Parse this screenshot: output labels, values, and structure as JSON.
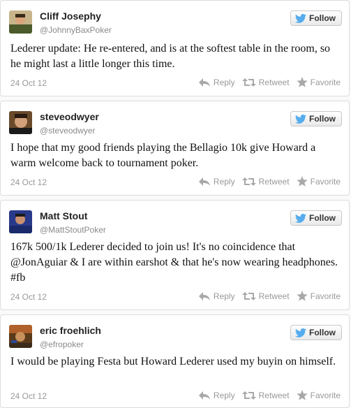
{
  "follow_label": "Follow",
  "actions": {
    "reply": "Reply",
    "retweet": "Retweet",
    "favorite": "Favorite"
  },
  "tweets": [
    {
      "name": "Cliff Josephy",
      "handle": "@JohnnyBaxPoker",
      "text": "Lederer update: He re-entered, and is at the softest table in the room, so he might last a little longer this time.",
      "date": "24 Oct 12"
    },
    {
      "name": "steveodwyer",
      "handle": "@steveodwyer",
      "text": "I hope that my good friends playing the Bellagio 10k give Howard a warm welcome back to tournament poker.",
      "date": "24 Oct 12"
    },
    {
      "name": "Matt Stout",
      "handle": "@MattStoutPoker",
      "text": "167k 500/1k Lederer decided to join us! It's no coincidence that @JonAguiar & I are within earshot & that he's now wearing headphones. #fb",
      "date": "24 Oct 12"
    },
    {
      "name": "eric froehlich",
      "handle": "@efropoker",
      "text": "I would be playing Festa but Howard Lederer used my buyin on himself.",
      "date": "24 Oct 12"
    }
  ],
  "colors": {
    "follow_bird": "#55acee",
    "action_gray": "#999999"
  }
}
